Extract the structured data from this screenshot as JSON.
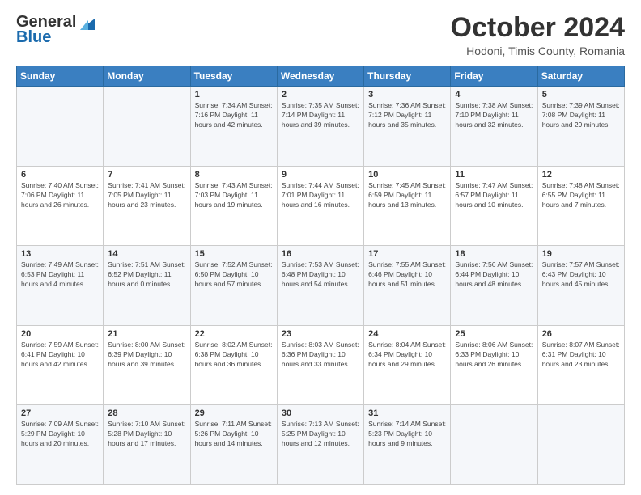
{
  "logo": {
    "general": "General",
    "blue": "Blue"
  },
  "header": {
    "month": "October 2024",
    "location": "Hodoni, Timis County, Romania"
  },
  "days_of_week": [
    "Sunday",
    "Monday",
    "Tuesday",
    "Wednesday",
    "Thursday",
    "Friday",
    "Saturday"
  ],
  "weeks": [
    [
      {
        "day": "",
        "info": ""
      },
      {
        "day": "",
        "info": ""
      },
      {
        "day": "1",
        "info": "Sunrise: 7:34 AM\nSunset: 7:16 PM\nDaylight: 11 hours and 42 minutes."
      },
      {
        "day": "2",
        "info": "Sunrise: 7:35 AM\nSunset: 7:14 PM\nDaylight: 11 hours and 39 minutes."
      },
      {
        "day": "3",
        "info": "Sunrise: 7:36 AM\nSunset: 7:12 PM\nDaylight: 11 hours and 35 minutes."
      },
      {
        "day": "4",
        "info": "Sunrise: 7:38 AM\nSunset: 7:10 PM\nDaylight: 11 hours and 32 minutes."
      },
      {
        "day": "5",
        "info": "Sunrise: 7:39 AM\nSunset: 7:08 PM\nDaylight: 11 hours and 29 minutes."
      }
    ],
    [
      {
        "day": "6",
        "info": "Sunrise: 7:40 AM\nSunset: 7:06 PM\nDaylight: 11 hours and 26 minutes."
      },
      {
        "day": "7",
        "info": "Sunrise: 7:41 AM\nSunset: 7:05 PM\nDaylight: 11 hours and 23 minutes."
      },
      {
        "day": "8",
        "info": "Sunrise: 7:43 AM\nSunset: 7:03 PM\nDaylight: 11 hours and 19 minutes."
      },
      {
        "day": "9",
        "info": "Sunrise: 7:44 AM\nSunset: 7:01 PM\nDaylight: 11 hours and 16 minutes."
      },
      {
        "day": "10",
        "info": "Sunrise: 7:45 AM\nSunset: 6:59 PM\nDaylight: 11 hours and 13 minutes."
      },
      {
        "day": "11",
        "info": "Sunrise: 7:47 AM\nSunset: 6:57 PM\nDaylight: 11 hours and 10 minutes."
      },
      {
        "day": "12",
        "info": "Sunrise: 7:48 AM\nSunset: 6:55 PM\nDaylight: 11 hours and 7 minutes."
      }
    ],
    [
      {
        "day": "13",
        "info": "Sunrise: 7:49 AM\nSunset: 6:53 PM\nDaylight: 11 hours and 4 minutes."
      },
      {
        "day": "14",
        "info": "Sunrise: 7:51 AM\nSunset: 6:52 PM\nDaylight: 11 hours and 0 minutes."
      },
      {
        "day": "15",
        "info": "Sunrise: 7:52 AM\nSunset: 6:50 PM\nDaylight: 10 hours and 57 minutes."
      },
      {
        "day": "16",
        "info": "Sunrise: 7:53 AM\nSunset: 6:48 PM\nDaylight: 10 hours and 54 minutes."
      },
      {
        "day": "17",
        "info": "Sunrise: 7:55 AM\nSunset: 6:46 PM\nDaylight: 10 hours and 51 minutes."
      },
      {
        "day": "18",
        "info": "Sunrise: 7:56 AM\nSunset: 6:44 PM\nDaylight: 10 hours and 48 minutes."
      },
      {
        "day": "19",
        "info": "Sunrise: 7:57 AM\nSunset: 6:43 PM\nDaylight: 10 hours and 45 minutes."
      }
    ],
    [
      {
        "day": "20",
        "info": "Sunrise: 7:59 AM\nSunset: 6:41 PM\nDaylight: 10 hours and 42 minutes."
      },
      {
        "day": "21",
        "info": "Sunrise: 8:00 AM\nSunset: 6:39 PM\nDaylight: 10 hours and 39 minutes."
      },
      {
        "day": "22",
        "info": "Sunrise: 8:02 AM\nSunset: 6:38 PM\nDaylight: 10 hours and 36 minutes."
      },
      {
        "day": "23",
        "info": "Sunrise: 8:03 AM\nSunset: 6:36 PM\nDaylight: 10 hours and 33 minutes."
      },
      {
        "day": "24",
        "info": "Sunrise: 8:04 AM\nSunset: 6:34 PM\nDaylight: 10 hours and 29 minutes."
      },
      {
        "day": "25",
        "info": "Sunrise: 8:06 AM\nSunset: 6:33 PM\nDaylight: 10 hours and 26 minutes."
      },
      {
        "day": "26",
        "info": "Sunrise: 8:07 AM\nSunset: 6:31 PM\nDaylight: 10 hours and 23 minutes."
      }
    ],
    [
      {
        "day": "27",
        "info": "Sunrise: 7:09 AM\nSunset: 5:29 PM\nDaylight: 10 hours and 20 minutes."
      },
      {
        "day": "28",
        "info": "Sunrise: 7:10 AM\nSunset: 5:28 PM\nDaylight: 10 hours and 17 minutes."
      },
      {
        "day": "29",
        "info": "Sunrise: 7:11 AM\nSunset: 5:26 PM\nDaylight: 10 hours and 14 minutes."
      },
      {
        "day": "30",
        "info": "Sunrise: 7:13 AM\nSunset: 5:25 PM\nDaylight: 10 hours and 12 minutes."
      },
      {
        "day": "31",
        "info": "Sunrise: 7:14 AM\nSunset: 5:23 PM\nDaylight: 10 hours and 9 minutes."
      },
      {
        "day": "",
        "info": ""
      },
      {
        "day": "",
        "info": ""
      }
    ]
  ]
}
